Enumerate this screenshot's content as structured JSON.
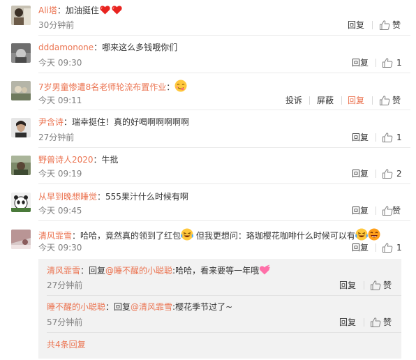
{
  "comments": [
    {
      "user": "Ali塔",
      "text": "：加油挺住",
      "time": "30分钟前",
      "actions": {
        "reply": "回复",
        "like": "赞"
      }
    },
    {
      "user": "dddamonone",
      "text": "：哪来这么多钱哦你们",
      "time": "今天 09:30",
      "actions": {
        "reply": "回复",
        "like": "1"
      }
    },
    {
      "user": "7岁男童惨遭8名老师轮流布置作业",
      "text": "：",
      "time": "今天 09:11",
      "actions": {
        "report": "投诉",
        "block": "屏蔽",
        "reply": "回复",
        "like": "赞"
      }
    },
    {
      "user": "尹含诗",
      "text": "：瑞幸挺住！真的好喝啊啊啊啊啊",
      "time": "27分钟前",
      "actions": {
        "reply": "回复",
        "like": "1"
      }
    },
    {
      "user": "野兽诗人2020",
      "text": "：牛批",
      "time": "今天 09:19",
      "actions": {
        "reply": "回复",
        "like": "2"
      }
    },
    {
      "user": "从早到晚想睡觉",
      "text": "：555果汁什么时候有啊",
      "time": "今天 09:45",
      "actions": {
        "reply": "回复",
        "like": "赞"
      }
    },
    {
      "user": "清风霏雪",
      "text": "：哈哈，竟然真的领到了红包",
      "text2": " 但我更想问：珞珈樱花咖啡什么时候可以有",
      "time": "今天 09:30",
      "actions": {
        "reply": "回复",
        "like": "1"
      }
    }
  ],
  "replies": [
    {
      "user": "清风霏雪",
      "prefix": "：回复",
      "mention": "@睡不醒的小聪聪",
      "text": ":哈哈，看来要等一年哦",
      "time": "27分钟前",
      "actions": {
        "reply": "回复",
        "like": "赞"
      }
    },
    {
      "user": "睡不醒的小聪聪",
      "prefix": "：回复",
      "mention": "@清风霏雪",
      "text": ":樱花季节过了~",
      "time": "57分钟前",
      "actions": {
        "reply": "回复",
        "like": "赞"
      }
    }
  ],
  "more_replies": "共4条回复",
  "colors": {
    "link": "#eb7350",
    "muted": "#808080",
    "reply_bg": "#f2f2f2"
  }
}
